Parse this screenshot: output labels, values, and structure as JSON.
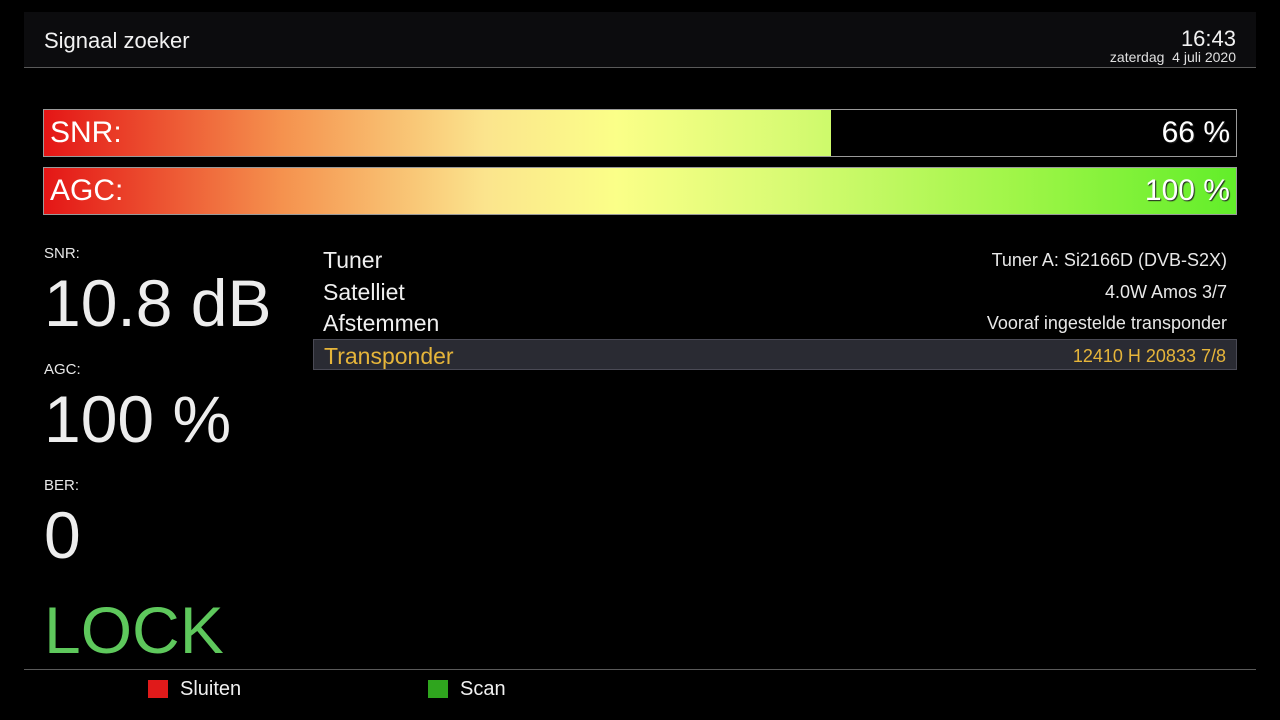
{
  "header": {
    "title": "Signaal zoeker",
    "time": "16:43",
    "date": "zaterdag  4 juli 2020"
  },
  "bars": {
    "snr": {
      "label": "SNR:",
      "value_text": "66 %",
      "fill_percent": 66
    },
    "agc": {
      "label": "AGC:",
      "value_text": "100 %",
      "fill_percent": 100
    }
  },
  "stats": {
    "snr": {
      "label": "SNR:",
      "value": "10.8 dB"
    },
    "agc": {
      "label": "AGC:",
      "value": "100 %"
    },
    "ber": {
      "label": "BER:",
      "value": "0"
    },
    "lock": "LOCK"
  },
  "info": [
    {
      "label": "Tuner",
      "value": "Tuner A: Si2166D (DVB-S2X)"
    },
    {
      "label": "Satelliet",
      "value": "4.0W Amos 3/7"
    },
    {
      "label": "Afstemmen",
      "value": "Vooraf ingestelde transponder"
    },
    {
      "label": "Transponder",
      "value": "12410 H 20833 7/8"
    }
  ],
  "footer": {
    "red": {
      "label": "Sluiten",
      "color": "#e01a1a"
    },
    "green": {
      "label": "Scan",
      "color": "#2fa51e"
    }
  },
  "colors": {
    "lock": "#5ec85c",
    "selected_text": "#e6b53a"
  }
}
